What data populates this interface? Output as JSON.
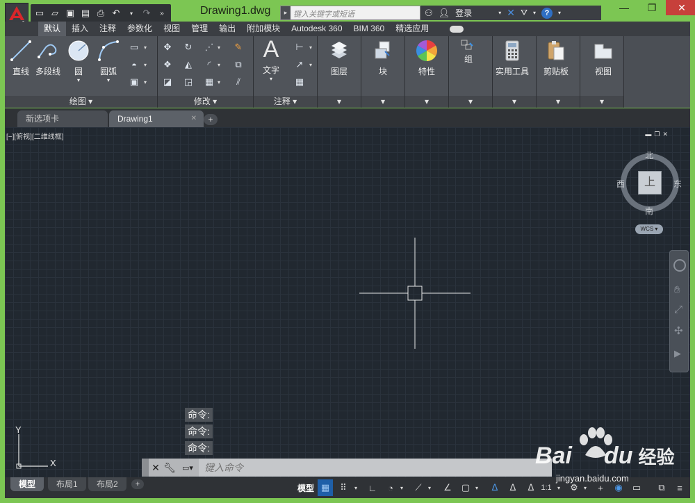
{
  "title": {
    "document": "Drawing1.dwg",
    "search_placeholder": "键入关键字或短语",
    "login": "登录"
  },
  "ribbon_tabs": [
    "默认",
    "插入",
    "注释",
    "参数化",
    "视图",
    "管理",
    "输出",
    "附加模块",
    "Autodesk 360",
    "BIM 360",
    "精选应用"
  ],
  "ribbon": {
    "draw": {
      "line": "直线",
      "polyline": "多段线",
      "circle": "圆",
      "arc": "圆弧",
      "label": "绘图"
    },
    "modify": {
      "label": "修改"
    },
    "annotation": {
      "text": "文字",
      "label": "注释"
    },
    "layers": "图层",
    "block": "块",
    "properties": "特性",
    "group": "组",
    "utilities": "实用工具",
    "clipboard": "剪贴板",
    "view": "视图"
  },
  "doc_tabs": [
    "新选项卡",
    "Drawing1"
  ],
  "viewport": {
    "label": "[−][俯视][二维线框]",
    "compass": {
      "north": "北",
      "south": "南",
      "east": "东",
      "west": "西",
      "top": "上"
    },
    "wcs": "WCS",
    "axis_y": "Y",
    "axis_x": "X"
  },
  "command": {
    "history": [
      "命令:",
      "命令:",
      "命令:"
    ],
    "placeholder": "键入命令"
  },
  "layout_tabs": [
    "模型",
    "布局1",
    "布局2"
  ],
  "status": {
    "model": "模型",
    "scale": "1:1"
  },
  "watermark": {
    "brand": "Bai",
    "brand2": "du",
    "cn": "经验",
    "url": "jingyan.baidu.com"
  },
  "colors": {
    "accent": "#7cc653",
    "canvas": "#212830",
    "close": "#c7403b"
  }
}
